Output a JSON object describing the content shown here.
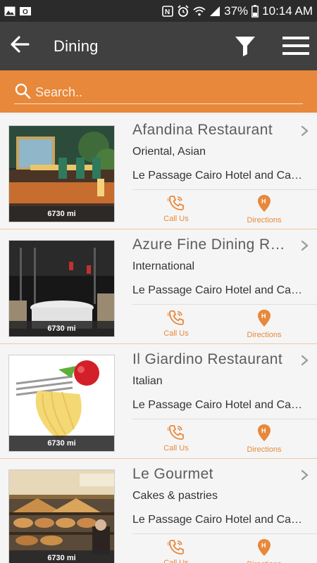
{
  "status": {
    "icons": [
      "image-icon",
      "outlook-icon"
    ],
    "right_icons": [
      "nfc-icon",
      "alarm-icon",
      "wifi-icon",
      "signal-icon"
    ],
    "battery": "37%",
    "time": "10:14 AM"
  },
  "appbar": {
    "title": "Dining"
  },
  "search": {
    "placeholder": "Search.."
  },
  "colors": {
    "accent": "#e8883a",
    "appbar": "#404040",
    "statusbar": "#2b2b2b"
  },
  "actions": {
    "call_label": "Call Us",
    "directions_label": "Directions"
  },
  "items": [
    {
      "name": "Afandina Restaurant",
      "category": "Oriental, Asian",
      "address": "Le Passage Cairo Hotel and Casino",
      "distance": "6730 mi"
    },
    {
      "name": "Azure Fine Dining Restaurant",
      "category": "International",
      "address": "Le Passage Cairo Hotel and Casino",
      "distance": "6730 mi"
    },
    {
      "name": "Il Giardino Restaurant",
      "category": "Italian",
      "address": "Le Passage Cairo Hotel and Casino",
      "distance": "6730 mi"
    },
    {
      "name": "Le Gourmet",
      "category": "Cakes & pastries",
      "address": "Le Passage Cairo Hotel and Casino",
      "distance": "6730 mi"
    }
  ]
}
